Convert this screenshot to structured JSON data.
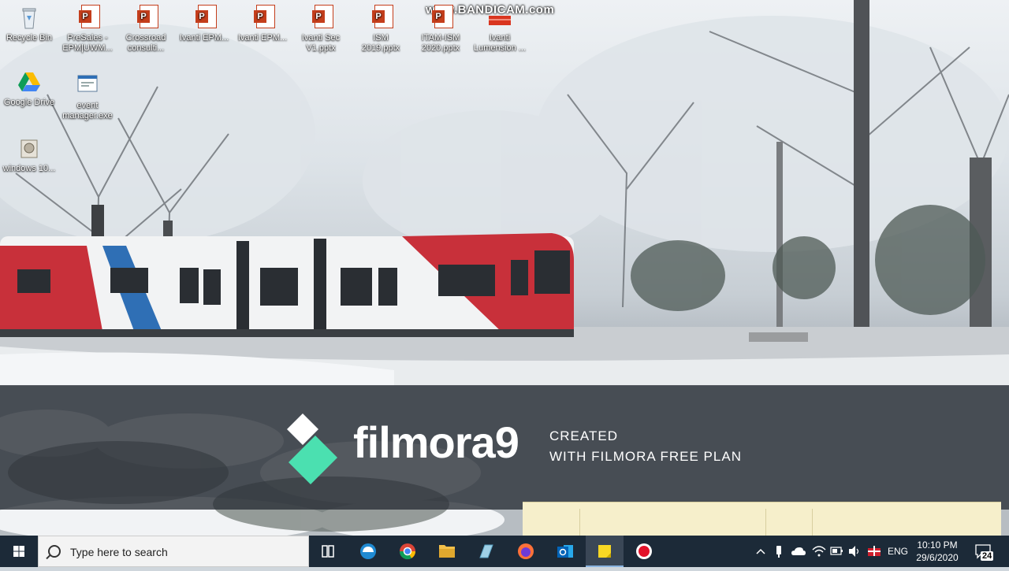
{
  "watermark": "www.BANDICAM.com",
  "desktop_icons": [
    {
      "name": "recycle-bin",
      "label": "Recycle Bin"
    },
    {
      "name": "presales",
      "label": "PreSales -\nEPM|UWM..."
    },
    {
      "name": "crossroad",
      "label": "Crossroad\nconsulti..."
    },
    {
      "name": "ivanti-epm-1",
      "label": "Ivanti EPM..."
    },
    {
      "name": "ivanti-epm-2",
      "label": "Ivanti EPM..."
    },
    {
      "name": "ivanti-sec",
      "label": "Ivanti Sec\nV1.pptx"
    },
    {
      "name": "ism-2019",
      "label": "ISM\n2019.pptx"
    },
    {
      "name": "itam-ism",
      "label": "ITAM-ISM\n2020.pptx"
    },
    {
      "name": "ivanti-lumension",
      "label": "Ivanti\nLumension ..."
    },
    {
      "name": "google-drive",
      "label": "Google Drive"
    },
    {
      "name": "event-manager",
      "label": "event\nmanager.exe"
    },
    {
      "name": "windows-10",
      "label": "windows 10..."
    }
  ],
  "filmora": {
    "brand": "filmora9",
    "line1": "CREATED",
    "line2": "WITH FILMORA FREE PLAN"
  },
  "taskbar": {
    "search_placeholder": "Type here to search",
    "apps": [
      "task-view",
      "edge",
      "chrome",
      "file-explorer",
      "unknown-app",
      "firefox",
      "outlook",
      "sticky-notes",
      "bandicam-recorder"
    ],
    "tray_language": "ENG",
    "time": "10:10 PM",
    "date": "29/6/2020",
    "notification_count": "24"
  },
  "colors": {
    "taskbar": "#1c2a38",
    "filmora_accent": "#4be0b0",
    "ppt_red": "#c43e1c",
    "tram_red": "#c8303a",
    "tram_blue": "#2f6fb5"
  }
}
